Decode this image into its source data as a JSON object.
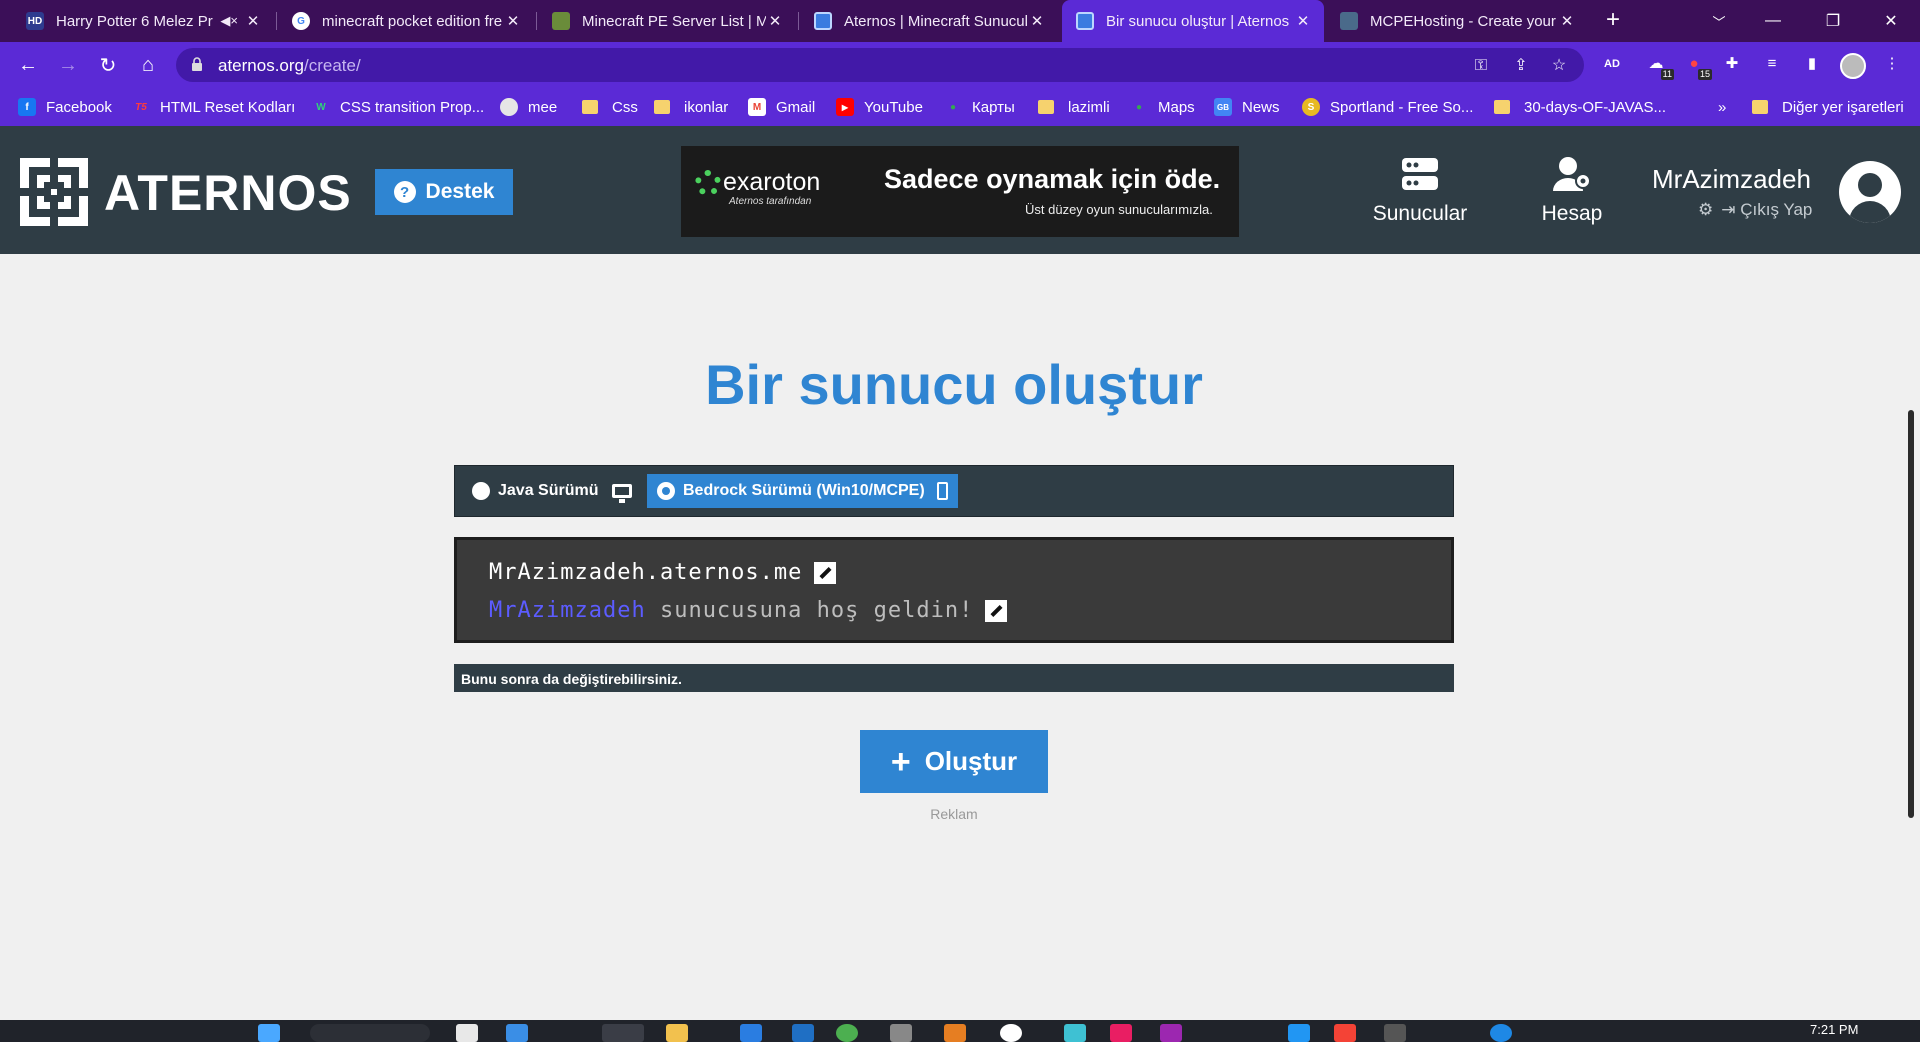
{
  "browser": {
    "tabs": [
      {
        "title": "Harry Potter 6 Melez Pr",
        "favicon_text": "HD",
        "favicon_color": "#2e3b8f",
        "muted": true,
        "active": false
      },
      {
        "title": "minecraft pocket edition fre",
        "favicon_text": "G",
        "favicon_color": "#ffffff",
        "muted": false,
        "active": false
      },
      {
        "title": "Minecraft PE Server List | M",
        "favicon_text": "",
        "favicon_color": "#6a8c3a",
        "muted": false,
        "active": false
      },
      {
        "title": "Aternos | Minecraft Sunucul",
        "favicon_text": "",
        "favicon_color": "#3a7be0",
        "muted": false,
        "active": false
      },
      {
        "title": "Bir sunucu oluştur | Aternos",
        "favicon_text": "",
        "favicon_color": "#3a7be0",
        "muted": false,
        "active": true
      },
      {
        "title": "MCPEHosting - Create your",
        "favicon_text": "",
        "favicon_color": "#4a6a8a",
        "muted": false,
        "active": false
      }
    ],
    "url_host": "aternos.org",
    "url_path": "/create/",
    "ext_badges": [
      "11",
      "15"
    ],
    "bookmarks": [
      {
        "label": "Facebook",
        "icon": "facebook-icon",
        "color": "#1877f2",
        "glyph": "f"
      },
      {
        "label": "HTML Reset Kodları",
        "icon": "t5-icon",
        "color": "#d61f1f",
        "glyph": "T5"
      },
      {
        "label": "CSS transition Prop...",
        "icon": "w-icon",
        "color": "#1d9b55",
        "glyph": "W"
      },
      {
        "label": "mee",
        "icon": "globe-icon",
        "color": "#e6e6e6",
        "glyph": ""
      },
      {
        "label": "Css",
        "icon": "folder-icon",
        "color": "#f6d26e",
        "glyph": ""
      },
      {
        "label": "ikonlar",
        "icon": "folder-icon",
        "color": "#f6d26e",
        "glyph": ""
      },
      {
        "label": "Gmail",
        "icon": "gmail-icon",
        "color": "#ea4335",
        "glyph": "M"
      },
      {
        "label": "YouTube",
        "icon": "youtube-icon",
        "color": "#ff0000",
        "glyph": "▶"
      },
      {
        "label": "Карты",
        "icon": "maps-icon",
        "color": "#34a853",
        "glyph": "●"
      },
      {
        "label": "lazimli",
        "icon": "folder-icon",
        "color": "#f6d26e",
        "glyph": ""
      },
      {
        "label": "Maps",
        "icon": "maps-icon",
        "color": "#34a853",
        "glyph": "●"
      },
      {
        "label": "News",
        "icon": "news-icon",
        "color": "#4285f4",
        "glyph": "GB"
      },
      {
        "label": "Sportland - Free So...",
        "icon": "sportland-icon",
        "color": "#e7b922",
        "glyph": "S"
      },
      {
        "label": "30-days-OF-JAVAS...",
        "icon": "folder-icon",
        "color": "#f6d26e",
        "glyph": ""
      }
    ],
    "more_bookmarks": "»",
    "other_bookmarks": "Diğer yer işaretleri"
  },
  "header": {
    "logo_text": "ATERNOS",
    "support_label": "Destek",
    "ad": {
      "brand": "exaroton",
      "brand_sub": "Aternos tarafından",
      "headline": "Sadece oynamak için öde.",
      "subline": "Üst düzey oyun sunucularımızla."
    },
    "nav": [
      {
        "label": "Sunucular",
        "icon": "servers-icon"
      },
      {
        "label": "Hesap",
        "icon": "account-icon"
      }
    ],
    "username": "MrAzimzadeh",
    "logout_label": "Çıkış Yap"
  },
  "main": {
    "title": "Bir sunucu oluştur",
    "editions": [
      {
        "label": "Java Sürümü",
        "selected": false
      },
      {
        "label": "Bedrock Sürümü (Win10/MCPE)",
        "selected": true
      }
    ],
    "server_address": "MrAzimzadeh.aternos.me",
    "motd_name": "MrAzimzadeh",
    "motd_text": "sunucusuna hoş geldin!",
    "note": "Bunu sonra da değiştirebilirsiniz.",
    "create_label": "Oluştur",
    "ad_label": "Reklam"
  },
  "taskbar": {
    "time": "7:21 PM"
  },
  "colors": {
    "accent": "#2f85d2",
    "header_bg": "#2f3d45",
    "browser_frame": "#5b2ad6",
    "motd_blue": "#5c5cff"
  }
}
